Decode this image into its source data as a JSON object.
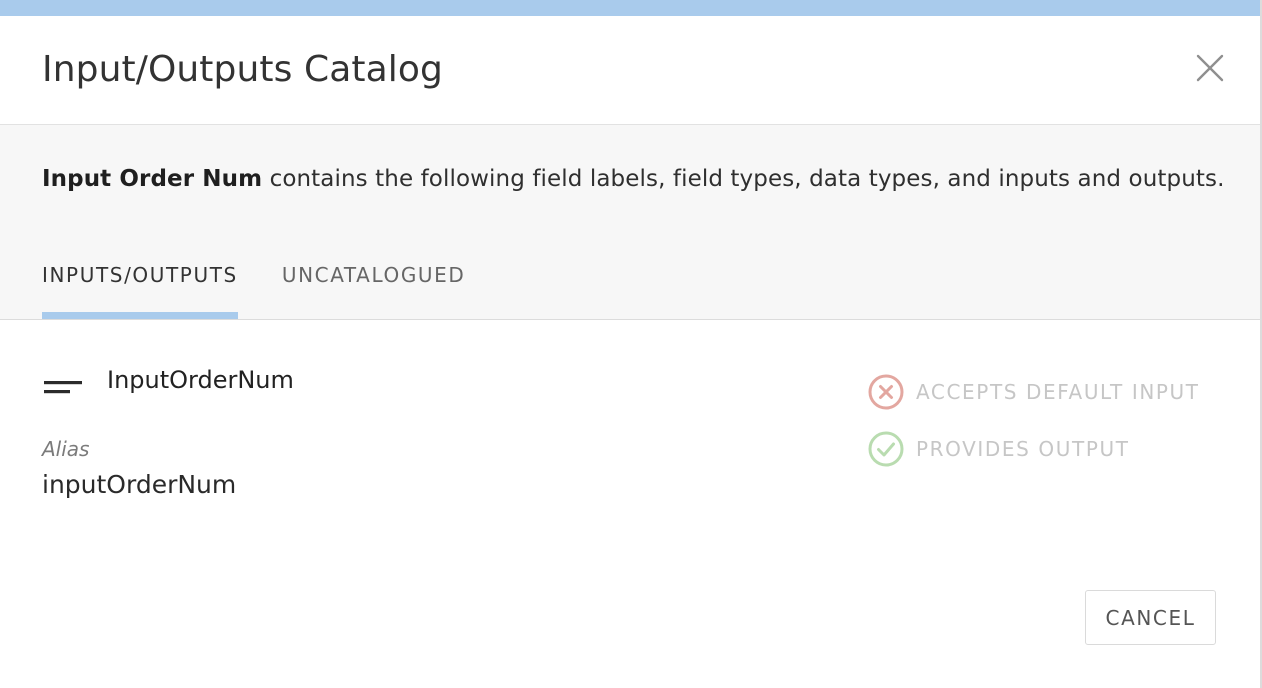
{
  "dialog": {
    "title": "Input/Outputs Catalog"
  },
  "description": {
    "name": "Input Order Num",
    "text": " contains the following field labels, field types, data types, and inputs and outputs."
  },
  "tabs": [
    {
      "label": "INPUTS/OUTPUTS",
      "active": true
    },
    {
      "label": "UNCATALOGUED",
      "active": false
    }
  ],
  "field": {
    "icon": "short-text-icon",
    "name": "InputOrderNum",
    "alias_label": "Alias",
    "alias_value": "inputOrderNum"
  },
  "capabilities": [
    {
      "label": "ACCEPTS DEFAULT INPUT",
      "enabled": false,
      "icon": "x-circle-icon",
      "color": "#e3a7a0"
    },
    {
      "label": "PROVIDES OUTPUT",
      "enabled": true,
      "icon": "check-circle-icon",
      "color": "#b9dcb0"
    }
  ],
  "footer": {
    "cancel_label": "CANCEL"
  },
  "colors": {
    "accent": "#a9cbec",
    "subheader_bg": "#f7f7f7"
  }
}
